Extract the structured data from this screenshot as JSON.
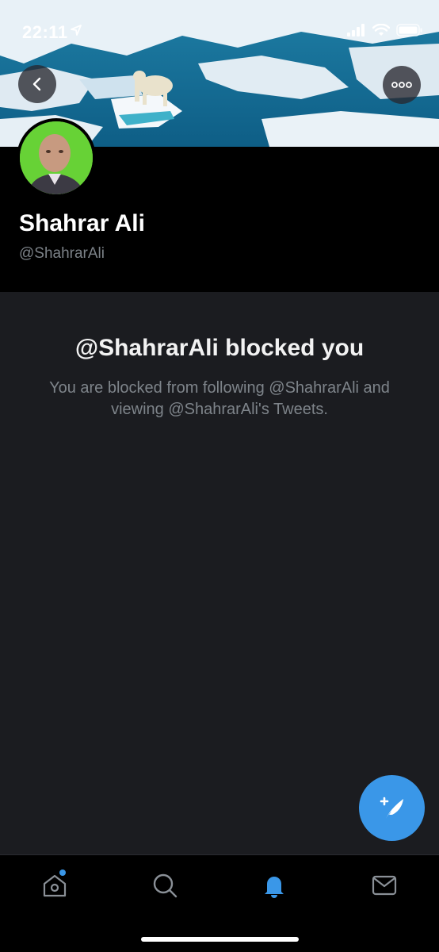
{
  "status_bar": {
    "time": "22:11",
    "icons": [
      "location-arrow-icon",
      "signal-icon",
      "wifi-icon",
      "battery-icon"
    ]
  },
  "header": {
    "back_icon": "chevron-left-icon",
    "more_icon": "ellipsis-icon"
  },
  "profile": {
    "name": "Shahrar Ali",
    "handle": "@ShahrarAli"
  },
  "blocked": {
    "title": "@ShahrarAli blocked you",
    "description": "You are blocked from following @ShahrarAli and viewing @ShahrarAli's Tweets."
  },
  "fab": {
    "icon": "compose-tweet-icon"
  },
  "tabbar": {
    "items": [
      {
        "name": "home",
        "icon": "home-icon",
        "has_dot": true
      },
      {
        "name": "search",
        "icon": "search-icon"
      },
      {
        "name": "notifications",
        "icon": "bell-icon",
        "active": true
      },
      {
        "name": "messages",
        "icon": "mail-icon"
      }
    ]
  },
  "colors": {
    "accent": "#3a97e8",
    "background": "#000000",
    "panel": "#1b1c20",
    "muted_text": "#7e848a"
  }
}
